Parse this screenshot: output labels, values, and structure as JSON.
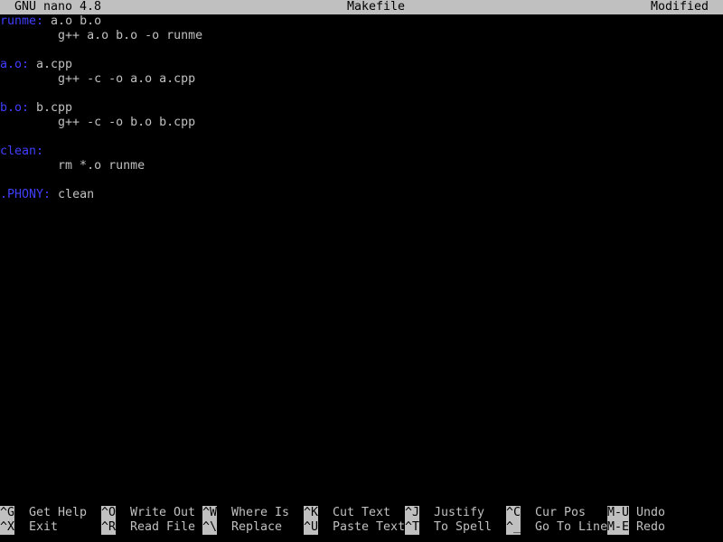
{
  "titlebar": {
    "app": "GNU nano 4.8",
    "filename": "Makefile",
    "status": "Modified"
  },
  "lines": [
    {
      "target": "runme:",
      "rest": " a.o b.o"
    },
    {
      "target": "",
      "rest": "        g++ a.o b.o -o runme"
    },
    {
      "target": "",
      "rest": ""
    },
    {
      "target": "a.o:",
      "rest": " a.cpp"
    },
    {
      "target": "",
      "rest": "        g++ -c -o a.o a.cpp"
    },
    {
      "target": "",
      "rest": ""
    },
    {
      "target": "b.o:",
      "rest": " b.cpp"
    },
    {
      "target": "",
      "rest": "        g++ -c -o b.o b.cpp"
    },
    {
      "target": "",
      "rest": ""
    },
    {
      "target": "clean:",
      "rest": ""
    },
    {
      "target": "",
      "rest": "        rm *.o runme"
    },
    {
      "target": "",
      "rest": ""
    },
    {
      "target": ".PHONY:",
      "rest": " clean"
    }
  ],
  "shortcuts": [
    {
      "key": "^G",
      "label": "Get Help",
      "name": "get-help"
    },
    {
      "key": "^O",
      "label": "Write Out",
      "name": "write-out"
    },
    {
      "key": "^W",
      "label": "Where Is",
      "name": "where-is"
    },
    {
      "key": "^K",
      "label": "Cut Text",
      "name": "cut-text"
    },
    {
      "key": "^J",
      "label": "Justify",
      "name": "justify"
    },
    {
      "key": "^C",
      "label": "Cur Pos",
      "name": "cur-pos"
    },
    {
      "key": "M-U",
      "label": "Undo",
      "name": "undo"
    },
    {
      "key": "^X",
      "label": "Exit",
      "name": "exit"
    },
    {
      "key": "^R",
      "label": "Read File",
      "name": "read-file"
    },
    {
      "key": "^\\",
      "label": "Replace",
      "name": "replace"
    },
    {
      "key": "^U",
      "label": "Paste Text",
      "name": "paste-text"
    },
    {
      "key": "^T",
      "label": "To Spell",
      "name": "to-spell"
    },
    {
      "key": "^_",
      "label": "Go To Line",
      "name": "go-to-line"
    },
    {
      "key": "M-E",
      "label": "Redo",
      "name": "redo"
    }
  ],
  "colors": {
    "background": "#000000",
    "text": "#c0c0c0",
    "target": "#3f3fff",
    "bar": "#c0c0c0"
  }
}
